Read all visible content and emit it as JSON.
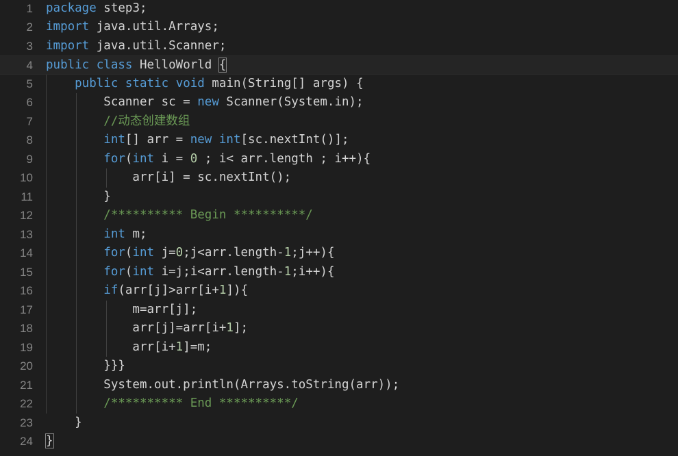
{
  "editor": {
    "lines": [
      {
        "num": "1",
        "tokens": [
          {
            "t": "package",
            "c": "kw"
          },
          {
            "t": " step3;",
            "c": "ident"
          }
        ]
      },
      {
        "num": "2",
        "tokens": [
          {
            "t": "import",
            "c": "kw"
          },
          {
            "t": " java.util.Arrays;",
            "c": "ident"
          }
        ]
      },
      {
        "num": "3",
        "tokens": [
          {
            "t": "import",
            "c": "kw"
          },
          {
            "t": " java.util.Scanner;",
            "c": "ident"
          }
        ]
      },
      {
        "num": "4",
        "tokens": [
          {
            "t": "public",
            "c": "kw"
          },
          {
            "t": " ",
            "c": "ident"
          },
          {
            "t": "class",
            "c": "kw"
          },
          {
            "t": " HelloWorld ",
            "c": "ident"
          },
          {
            "t": "{",
            "c": "ident bracket"
          }
        ]
      },
      {
        "num": "5",
        "tokens": [
          {
            "t": "    ",
            "c": "ident"
          },
          {
            "t": "public",
            "c": "kw"
          },
          {
            "t": " ",
            "c": "ident"
          },
          {
            "t": "static",
            "c": "kw"
          },
          {
            "t": " ",
            "c": "ident"
          },
          {
            "t": "void",
            "c": "kw"
          },
          {
            "t": " main(String[] args) {",
            "c": "ident"
          }
        ]
      },
      {
        "num": "6",
        "tokens": [
          {
            "t": "        Scanner sc = ",
            "c": "ident"
          },
          {
            "t": "new",
            "c": "kw"
          },
          {
            "t": " Scanner(System.in);",
            "c": "ident"
          }
        ]
      },
      {
        "num": "7",
        "tokens": [
          {
            "t": "        ",
            "c": "ident"
          },
          {
            "t": "//动态创建数组",
            "c": "cm"
          }
        ]
      },
      {
        "num": "8",
        "tokens": [
          {
            "t": "        ",
            "c": "ident"
          },
          {
            "t": "int",
            "c": "kw"
          },
          {
            "t": "[] arr = ",
            "c": "ident"
          },
          {
            "t": "new",
            "c": "kw"
          },
          {
            "t": " ",
            "c": "ident"
          },
          {
            "t": "int",
            "c": "kw"
          },
          {
            "t": "[sc.nextInt()];",
            "c": "ident"
          }
        ]
      },
      {
        "num": "9",
        "tokens": [
          {
            "t": "        ",
            "c": "ident"
          },
          {
            "t": "for",
            "c": "kw"
          },
          {
            "t": "(",
            "c": "ident"
          },
          {
            "t": "int",
            "c": "kw"
          },
          {
            "t": " i = ",
            "c": "ident"
          },
          {
            "t": "0",
            "c": "nm"
          },
          {
            "t": " ; i< arr.length ; i++){",
            "c": "ident"
          }
        ]
      },
      {
        "num": "10",
        "tokens": [
          {
            "t": "            arr[i] = sc.nextInt();",
            "c": "ident"
          }
        ]
      },
      {
        "num": "11",
        "tokens": [
          {
            "t": "        }",
            "c": "ident"
          }
        ]
      },
      {
        "num": "12",
        "tokens": [
          {
            "t": "        ",
            "c": "ident"
          },
          {
            "t": "/********** Begin **********/",
            "c": "cm"
          }
        ]
      },
      {
        "num": "13",
        "tokens": [
          {
            "t": "        ",
            "c": "ident"
          },
          {
            "t": "int",
            "c": "kw"
          },
          {
            "t": " m;",
            "c": "ident"
          }
        ]
      },
      {
        "num": "14",
        "tokens": [
          {
            "t": "        ",
            "c": "ident"
          },
          {
            "t": "for",
            "c": "kw"
          },
          {
            "t": "(",
            "c": "ident"
          },
          {
            "t": "int",
            "c": "kw"
          },
          {
            "t": " j=",
            "c": "ident"
          },
          {
            "t": "0",
            "c": "nm"
          },
          {
            "t": ";j<arr.length-",
            "c": "ident"
          },
          {
            "t": "1",
            "c": "nm"
          },
          {
            "t": ";j++){",
            "c": "ident"
          }
        ]
      },
      {
        "num": "15",
        "tokens": [
          {
            "t": "        ",
            "c": "ident"
          },
          {
            "t": "for",
            "c": "kw"
          },
          {
            "t": "(",
            "c": "ident"
          },
          {
            "t": "int",
            "c": "kw"
          },
          {
            "t": " i=j;i<arr.length-",
            "c": "ident"
          },
          {
            "t": "1",
            "c": "nm"
          },
          {
            "t": ";i++){",
            "c": "ident"
          }
        ]
      },
      {
        "num": "16",
        "tokens": [
          {
            "t": "        ",
            "c": "ident"
          },
          {
            "t": "if",
            "c": "kw"
          },
          {
            "t": "(arr[j]>arr[i+",
            "c": "ident"
          },
          {
            "t": "1",
            "c": "nm"
          },
          {
            "t": "]){",
            "c": "ident"
          }
        ]
      },
      {
        "num": "17",
        "tokens": [
          {
            "t": "            m=arr[j];",
            "c": "ident"
          }
        ]
      },
      {
        "num": "18",
        "tokens": [
          {
            "t": "            arr[j]=arr[i+",
            "c": "ident"
          },
          {
            "t": "1",
            "c": "nm"
          },
          {
            "t": "];",
            "c": "ident"
          }
        ]
      },
      {
        "num": "19",
        "tokens": [
          {
            "t": "            arr[i+",
            "c": "ident"
          },
          {
            "t": "1",
            "c": "nm"
          },
          {
            "t": "]=m;",
            "c": "ident"
          }
        ]
      },
      {
        "num": "20",
        "tokens": [
          {
            "t": "        }}}",
            "c": "ident"
          }
        ]
      },
      {
        "num": "21",
        "tokens": [
          {
            "t": "        System.out.println(Arrays.toString(arr));",
            "c": "ident"
          }
        ]
      },
      {
        "num": "22",
        "tokens": [
          {
            "t": "        ",
            "c": "ident"
          },
          {
            "t": "/********** End **********/",
            "c": "cm"
          }
        ]
      },
      {
        "num": "23",
        "tokens": [
          {
            "t": "    }",
            "c": "ident"
          }
        ]
      },
      {
        "num": "24",
        "tokens": [
          {
            "t": "}",
            "c": "ident bracket"
          }
        ]
      }
    ]
  },
  "colors": {
    "background": "#1e1e1e",
    "keyword": "#569cd6",
    "comment": "#6a9955",
    "number": "#b5cea8",
    "text": "#d4d4d4",
    "line_number": "#858585"
  }
}
